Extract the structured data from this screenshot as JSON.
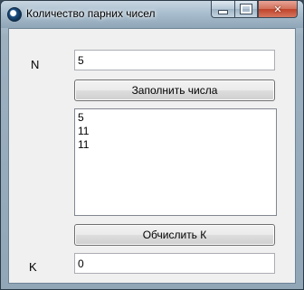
{
  "window": {
    "title": "Количество парних чисел",
    "icon": "app-icon",
    "caption_buttons": {
      "minimize": "minimize-icon",
      "maximize": "maximize-icon",
      "close": "✕"
    }
  },
  "form": {
    "n_label": "N",
    "n_value": "5",
    "fill_button_label": "Заполнить числа",
    "numbers_list": [
      "5",
      "11",
      "11"
    ],
    "compute_button_label": "Обчислить К",
    "k_label": "K",
    "k_value": "0"
  }
}
